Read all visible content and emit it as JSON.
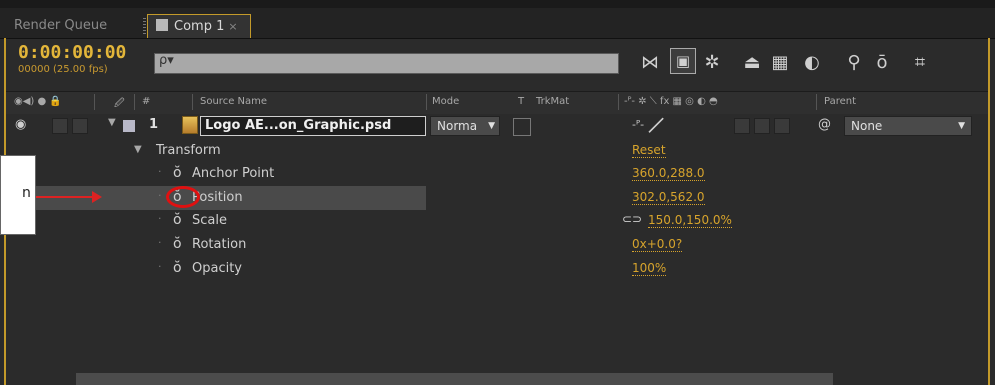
{
  "tabs": {
    "render_queue": "Render Queue",
    "comp": "Comp 1",
    "close": "×"
  },
  "header": {
    "timecode": "0:00:00:00",
    "fps": "00000 (25.00 fps)",
    "search_glyph": "ρ▾"
  },
  "toolbar_icons": [
    "draft-3d-icon",
    "frame-blending-icon",
    "solid-icon",
    "motion-blur-icon",
    "graph-editor-icon",
    "brush-icon",
    "pin-icon",
    "stopwatch-icon",
    "graph-icon"
  ],
  "columns": {
    "switches_glyph": "◉◀) ● 🔒",
    "tag_glyph": "🖉",
    "hash": "#",
    "source_name": "Source Name",
    "mode": "Mode",
    "t": "T",
    "trkmat": "TrkMat",
    "switches2": "-ᴾ- ✲ ⟍ fx ▦ ◎ ◐ ◓",
    "parent": "Parent"
  },
  "layer": {
    "number": "1",
    "name": "Logo AE...on_Graphic.psd",
    "mode": "Norma",
    "parent": "None"
  },
  "transform": {
    "label": "Transform",
    "reset": "Reset",
    "properties": [
      {
        "name": "Anchor Point",
        "value": "360.0,288.0"
      },
      {
        "name": "Position",
        "value": "302.0,562.0"
      },
      {
        "name": "Scale",
        "value": "150.0,150.0%"
      },
      {
        "name": "Rotation",
        "value": "0x+0.0?"
      },
      {
        "name": "Opacity",
        "value": "100%"
      }
    ]
  },
  "callout": {
    "text": "n"
  },
  "colors": {
    "accent": "#c39a2a",
    "value": "#d7a42c",
    "annotation": "#e01010"
  }
}
